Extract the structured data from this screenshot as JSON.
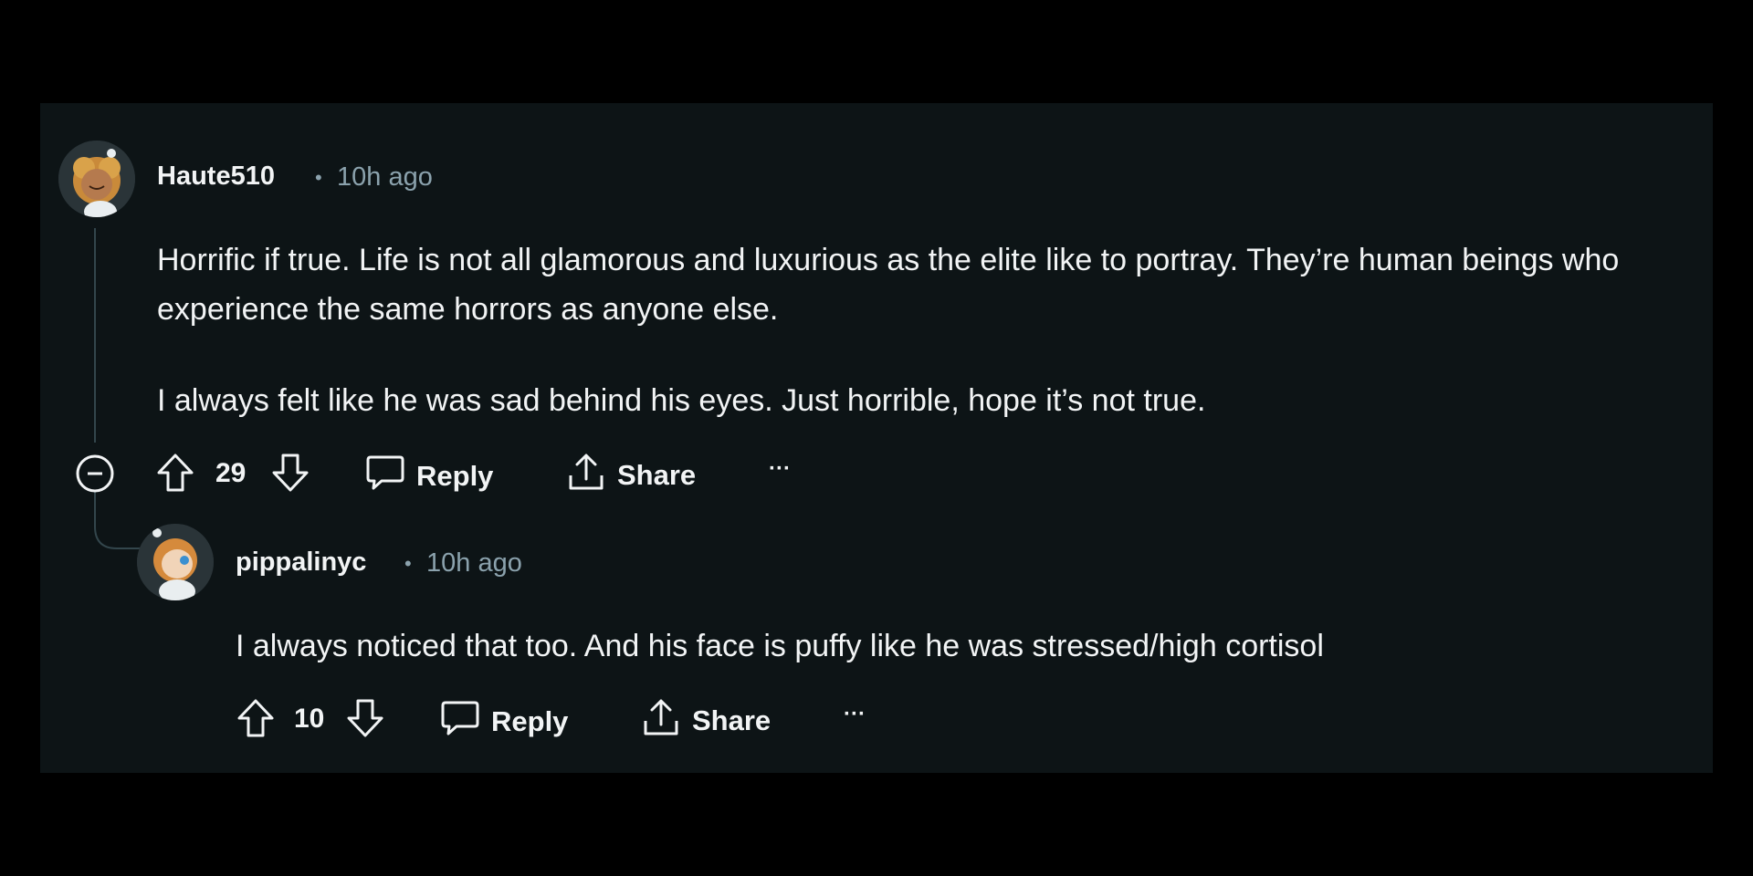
{
  "comments": [
    {
      "username": "Haute510",
      "separator": "•",
      "time": "10h ago",
      "paragraphs": [
        "Horrific if true. Life is not all glamorous and luxurious as the elite like to portray. They’re human beings who experience the same horrors as anyone else.",
        "I always felt like he was sad behind his eyes. Just horrible, hope it’s not true."
      ],
      "score": "29",
      "reply_label": "Reply",
      "share_label": "Share",
      "more_label": "···"
    },
    {
      "username": "pippalinyc",
      "separator": "•",
      "time": "10h ago",
      "paragraphs": [
        "I always noticed that too. And his face is puffy like he was stressed/high cortisol"
      ],
      "score": "10",
      "reply_label": "Reply",
      "share_label": "Share",
      "more_label": "···"
    }
  ],
  "colors": {
    "background": "#000000",
    "panel": "#0d1416",
    "text": "#f2f4f5",
    "muted": "#8ba2ad",
    "thread_line": "#33464c"
  },
  "icons": [
    "avatar",
    "collapse-icon",
    "upvote-icon",
    "downvote-icon",
    "comment-icon",
    "share-icon",
    "more-icon"
  ]
}
